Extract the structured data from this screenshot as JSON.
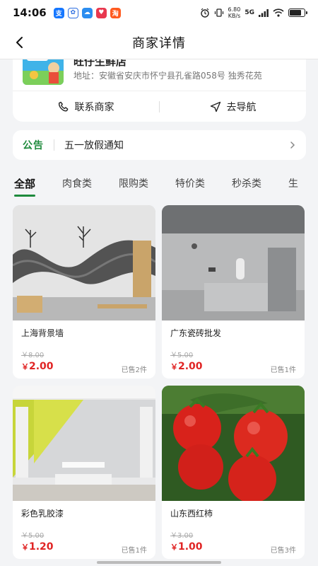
{
  "status_bar": {
    "time": "14:06",
    "speed_value": "6.80",
    "speed_unit": "KB/s",
    "network": "5G",
    "battery_percent": 80
  },
  "nav": {
    "title": "商家详情"
  },
  "merchant": {
    "name": "旺仔生鲜店",
    "address": "地址：安徽省安庆市怀宁县孔雀路058号 独秀花苑",
    "contact_label": "联系商家",
    "navigate_label": "去导航"
  },
  "notice": {
    "label": "公告",
    "text": "五一放假通知"
  },
  "tabs": [
    {
      "label": "全部"
    },
    {
      "label": "肉食类"
    },
    {
      "label": "限购类"
    },
    {
      "label": "特价类"
    },
    {
      "label": "秒杀类"
    },
    {
      "label": "生"
    }
  ],
  "products": [
    {
      "name": "上海背景墙",
      "original_price": "￥8.00",
      "currency": "￥",
      "price": "2.00",
      "sold": "已售2件"
    },
    {
      "name": "广东瓷砖批发",
      "original_price": "￥5.00",
      "currency": "￥",
      "price": "2.00",
      "sold": "已售1件"
    },
    {
      "name": "彩色乳胶漆",
      "original_price": "￥5.00",
      "currency": "￥",
      "price": "1.20",
      "sold": "已售1件"
    },
    {
      "name": "山东西红柿",
      "original_price": "￥3.00",
      "currency": "￥",
      "price": "1.00",
      "sold": "已售3件"
    }
  ],
  "colors": {
    "accent_green": "#1e8a3c",
    "price_red": "#e02424"
  }
}
